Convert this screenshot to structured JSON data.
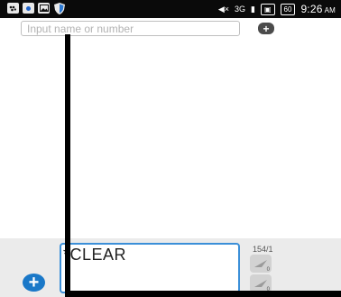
{
  "status_bar": {
    "network": "3G",
    "battery": "60",
    "time": "9:26",
    "ampm": "AM"
  },
  "recipient": {
    "placeholder": "Input name or number"
  },
  "compose": {
    "message_text": "*CLEAR",
    "char_counter": "154/1",
    "sim1_label": "0",
    "sim2_label": "0"
  },
  "colors": {
    "accent": "#3b8fd8",
    "attach_button": "#1a78c8",
    "status_bar": "#0a0a0a"
  }
}
